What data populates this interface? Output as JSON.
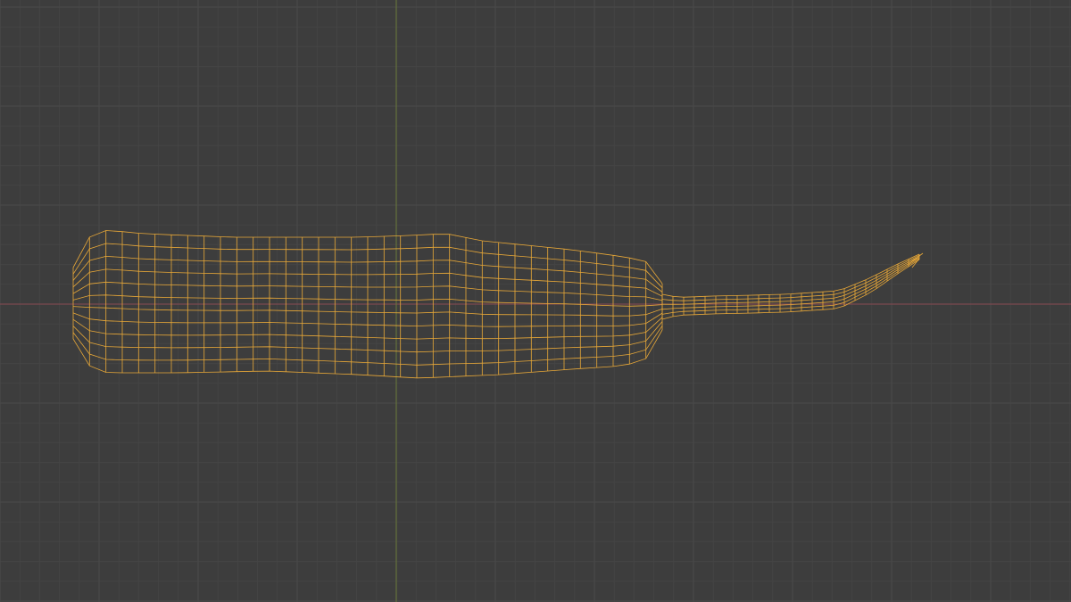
{
  "viewport": {
    "background_color": "#3d3d3d",
    "grid_minor_color": "#444444",
    "grid_major_color": "#4a4a4a",
    "x_axis_color": "#8a4a52",
    "y_axis_color": "#6b7a3a",
    "wireframe_color": "#e8a838",
    "object_name": "",
    "mode": "wireframe"
  }
}
